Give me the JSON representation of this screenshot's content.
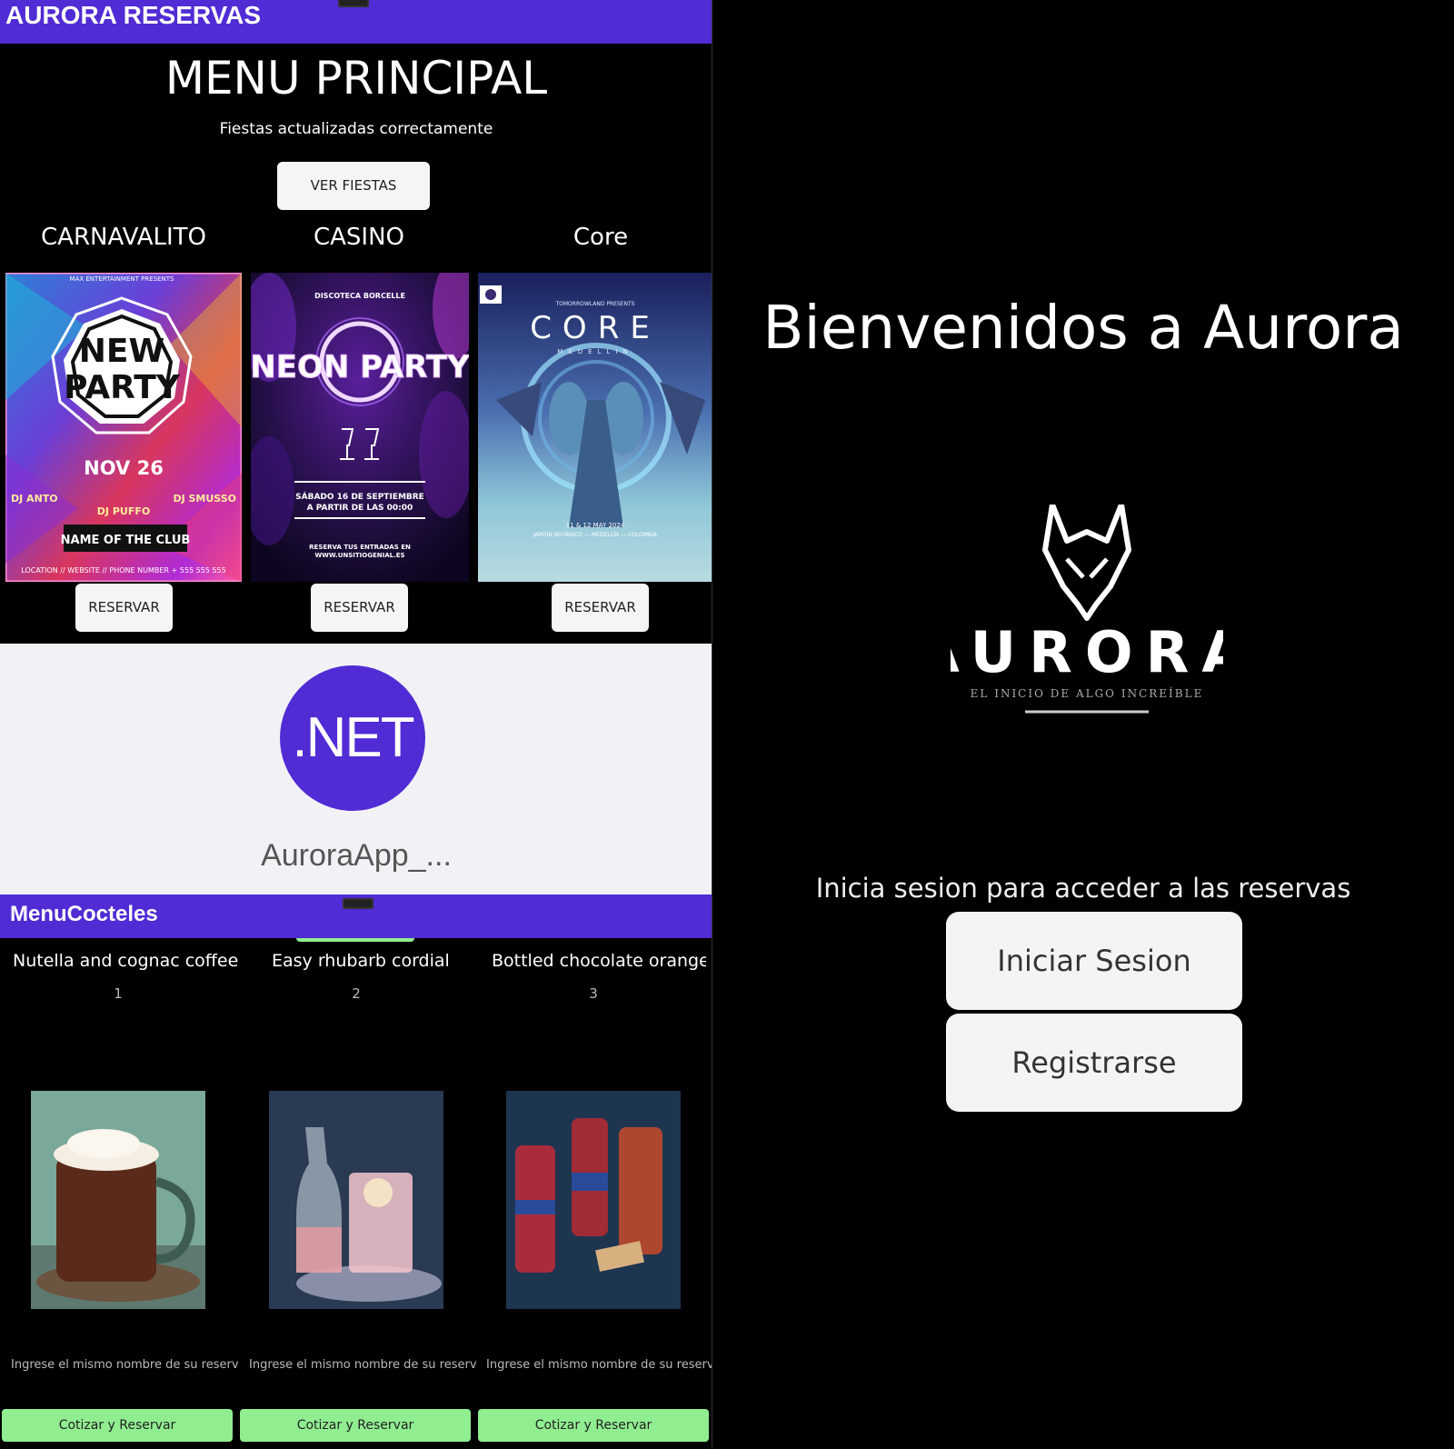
{
  "main_menu": {
    "app_title": "AURORA RESERVAS",
    "heading": "MENU PRINCIPAL",
    "status": "Fiestas actualizadas correctamente",
    "view_button": "VER FIESTAS",
    "parties": [
      {
        "name": "CARNAVALITO",
        "button": "RESERVAR",
        "poster": {
          "presents": "MAX ENTERTAINMENT PRESENTS",
          "line1": "NEW",
          "line2": "PARTY",
          "date": "NOV 26",
          "dj_left": "DJ ANTO",
          "dj_right": "DJ SMUSSO",
          "dj_center": "DJ PUFFO",
          "club": "NAME OF THE CLUB",
          "footer": "LOCATION // WEBSITE // PHONE NUMBER + 555 555 555"
        }
      },
      {
        "name": "CASINO",
        "button": "RESERVAR",
        "poster": {
          "presents": "DISCOTECA BORCELLE",
          "title": "NEON PARTY",
          "date_line1": "SÁBADO 16 DE SEPTIEMBRE",
          "date_line2": "A PARTIR DE LAS 00:00",
          "footer1": "RESERVA TUS ENTRADAS EN",
          "footer2": "WWW.UNSITIOGENIAL.ES"
        }
      },
      {
        "name": "Core",
        "button": "RESERVAR",
        "poster": {
          "presents": "TOMORROWLAND PRESENTS",
          "title": "CORE",
          "city": "MEDELLIN",
          "dates": "11 & 12 MAY 2024",
          "venue": "JARDÍN BOTÁNICO — MEDELLÍN — COLOMBIA"
        }
      }
    ]
  },
  "splash": {
    "logo_text": ".NET",
    "app_name": "AuroraApp_..."
  },
  "cocktail_menu": {
    "title": "MenuCocteles",
    "cocktails": [
      {
        "name": "Nutella and cognac coffee cocktail",
        "number": "1",
        "input_placeholder": "Ingrese el mismo nombre de su reserva",
        "button": "Cotizar y Reservar"
      },
      {
        "name": "Easy rhubarb cordial",
        "number": "2",
        "input_placeholder": "Ingrese el mismo nombre de su reserva",
        "button": "Cotizar y Reservar"
      },
      {
        "name": "Bottled chocolate orange negroni",
        "number": "3",
        "input_placeholder": "Ingrese el mismo nombre de su reserva",
        "button": "Cotizar y Reservar"
      }
    ]
  },
  "login": {
    "welcome": "Bienvenidos a Aurora",
    "logo_word": "AURORA",
    "logo_tagline": "EL INICIO DE ALGO INCREÍBLE",
    "prompt": "Inicia sesion para acceder a las reservas",
    "login_button": "Iniciar Sesion",
    "register_button": "Registrarse"
  },
  "colors": {
    "accent": "#512bd4",
    "button_green": "#90ee90",
    "background": "#000000"
  }
}
